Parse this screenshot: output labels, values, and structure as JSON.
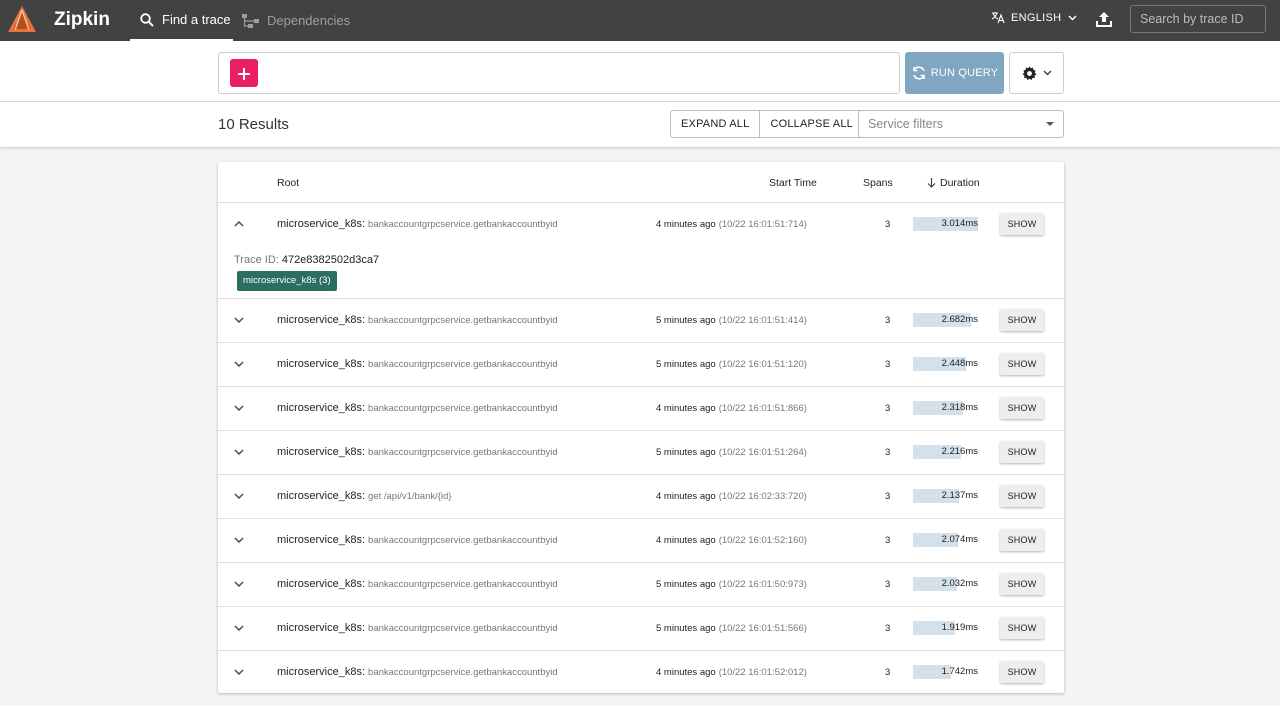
{
  "nav": {
    "brand": "Zipkin",
    "find_trace": "Find a trace",
    "dependencies": "Dependencies",
    "language": "ENGLISH",
    "search_placeholder": "Search by trace ID"
  },
  "query": {
    "run_label": "RUN QUERY"
  },
  "results": {
    "count_label": "10 Results",
    "expand_all": "EXPAND ALL",
    "collapse_all": "COLLAPSE ALL",
    "service_filters_placeholder": "Service filters"
  },
  "table": {
    "headers": {
      "root": "Root",
      "start_time": "Start Time",
      "spans": "Spans",
      "duration": "Duration"
    },
    "show_label": "SHOW",
    "expanded": {
      "trace_id_label": "Trace ID:",
      "trace_id": "472e8382502d3ca7",
      "badge": "microservice_k8s (3)"
    },
    "rows": [
      {
        "service": "microservice_k8s:",
        "operation": "bankaccountgrpcservice.getbankaccountbyid",
        "relative": "4 minutes ago",
        "timestamp": "(10/22 16:01:51:714)",
        "spans": "3",
        "duration": "3.014ms",
        "duration_fraction": 1.0
      },
      {
        "service": "microservice_k8s:",
        "operation": "bankaccountgrpcservice.getbankaccountbyid",
        "relative": "5 minutes ago",
        "timestamp": "(10/22 16:01:51:414)",
        "spans": "3",
        "duration": "2.682ms",
        "duration_fraction": 0.89
      },
      {
        "service": "microservice_k8s:",
        "operation": "bankaccountgrpcservice.getbankaccountbyid",
        "relative": "5 minutes ago",
        "timestamp": "(10/22 16:01:51:120)",
        "spans": "3",
        "duration": "2.448ms",
        "duration_fraction": 0.81
      },
      {
        "service": "microservice_k8s:",
        "operation": "bankaccountgrpcservice.getbankaccountbyid",
        "relative": "4 minutes ago",
        "timestamp": "(10/22 16:01:51:866)",
        "spans": "3",
        "duration": "2.318ms",
        "duration_fraction": 0.77
      },
      {
        "service": "microservice_k8s:",
        "operation": "bankaccountgrpcservice.getbankaccountbyid",
        "relative": "5 minutes ago",
        "timestamp": "(10/22 16:01:51:264)",
        "spans": "3",
        "duration": "2.216ms",
        "duration_fraction": 0.74
      },
      {
        "service": "microservice_k8s:",
        "operation": "get /api/v1/bank/{id}",
        "relative": "4 minutes ago",
        "timestamp": "(10/22 16:02:33:720)",
        "spans": "3",
        "duration": "2.137ms",
        "duration_fraction": 0.71
      },
      {
        "service": "microservice_k8s:",
        "operation": "bankaccountgrpcservice.getbankaccountbyid",
        "relative": "4 minutes ago",
        "timestamp": "(10/22 16:01:52:160)",
        "spans": "3",
        "duration": "2.074ms",
        "duration_fraction": 0.69
      },
      {
        "service": "microservice_k8s:",
        "operation": "bankaccountgrpcservice.getbankaccountbyid",
        "relative": "5 minutes ago",
        "timestamp": "(10/22 16:01:50:973)",
        "spans": "3",
        "duration": "2.032ms",
        "duration_fraction": 0.67
      },
      {
        "service": "microservice_k8s:",
        "operation": "bankaccountgrpcservice.getbankaccountbyid",
        "relative": "5 minutes ago",
        "timestamp": "(10/22 16:01:51:566)",
        "spans": "3",
        "duration": "1.919ms",
        "duration_fraction": 0.64
      },
      {
        "service": "microservice_k8s:",
        "operation": "bankaccountgrpcservice.getbankaccountbyid",
        "relative": "4 minutes ago",
        "timestamp": "(10/22 16:01:52:012)",
        "spans": "3",
        "duration": "1.742ms",
        "duration_fraction": 0.58
      }
    ]
  },
  "colors": {
    "accent": "#e91e63",
    "run_button": "#7fa7c1",
    "badge": "#2c6e62",
    "topbar": "#424242",
    "duration_bar": "#d4e0ea"
  },
  "icons": {
    "logo": "zipkin-logo-icon",
    "search": "search-icon",
    "dependencies": "dependencies-icon",
    "language": "translate-icon",
    "upload": "upload-icon",
    "add": "plus-icon",
    "refresh": "refresh-icon",
    "settings": "gear-icon",
    "sort": "arrow-down-icon",
    "expand": "chevron-icon"
  }
}
